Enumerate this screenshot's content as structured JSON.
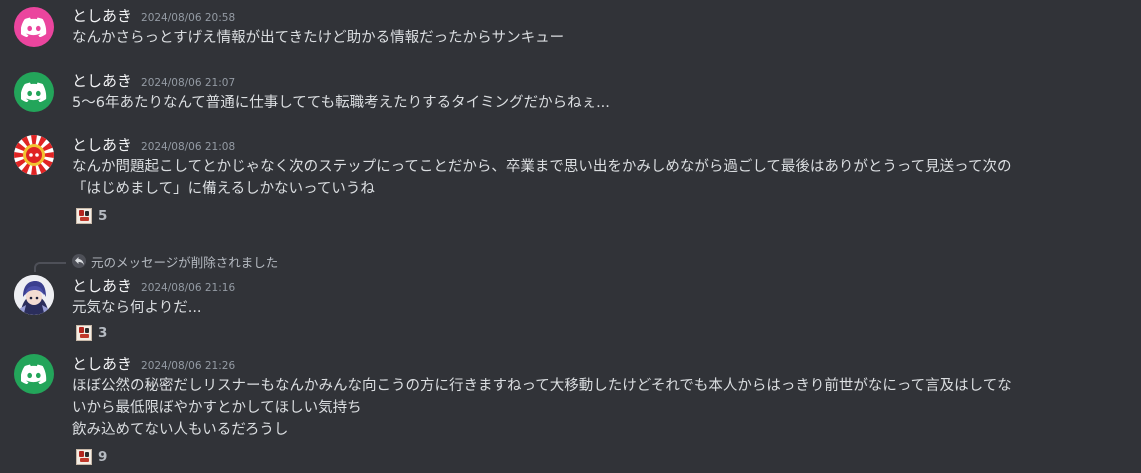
{
  "messages": [
    {
      "username": "としあき",
      "timestamp": "2024/08/06 20:58",
      "avatar": "discord-logo-pink",
      "lines": [
        "なんかさらっとすげえ情報が出てきたけど助かる情報だったからサンキュー"
      ]
    },
    {
      "username": "としあき",
      "timestamp": "2024/08/06 21:07",
      "avatar": "discord-logo-green",
      "lines": [
        "5〜6年あたりなんて普通に仕事してても転職考えたりするタイミングだからねぇ..."
      ]
    },
    {
      "username": "としあき",
      "timestamp": "2024/08/06 21:08",
      "avatar": "sunburst-discord-logo",
      "lines": [
        "なんか問題起こしてとかじゃなく次のステップにってことだから、卒業まで思い出をかみしめながら過ごして最後はありがとうって見送って次の",
        "「はじめまして」に備えるしかないっていうね"
      ],
      "reaction_count": "5"
    },
    {
      "reply_context": "元のメッセージが削除されました",
      "username": "としあき",
      "timestamp": "2024/08/06 21:16",
      "avatar": "anime-character",
      "lines": [
        "元気なら何よりだ..."
      ],
      "reaction_count": "3"
    },
    {
      "username": "としあき",
      "timestamp": "2024/08/06 21:26",
      "avatar": "discord-logo-green",
      "lines": [
        "ほぼ公然の秘密だしリスナーもなんかみんな向こうの方に行きますねって大移動したけどそれでも本人からはっきり前世がなにって言及はしてな",
        "いから最低限ぼやかすとかしてほしい気持ち",
        "飲み込めてない人もいるだろうし"
      ],
      "reaction_count": "9"
    }
  ],
  "colors": {
    "background": "#313338",
    "pink_avatar": "#eb459e",
    "green_avatar": "#23a55a",
    "text": "#dbdee1",
    "muted": "#949ba4"
  },
  "icons": {
    "reply": "reply-arrow-icon",
    "reaction": "custom-emoji-icon"
  }
}
